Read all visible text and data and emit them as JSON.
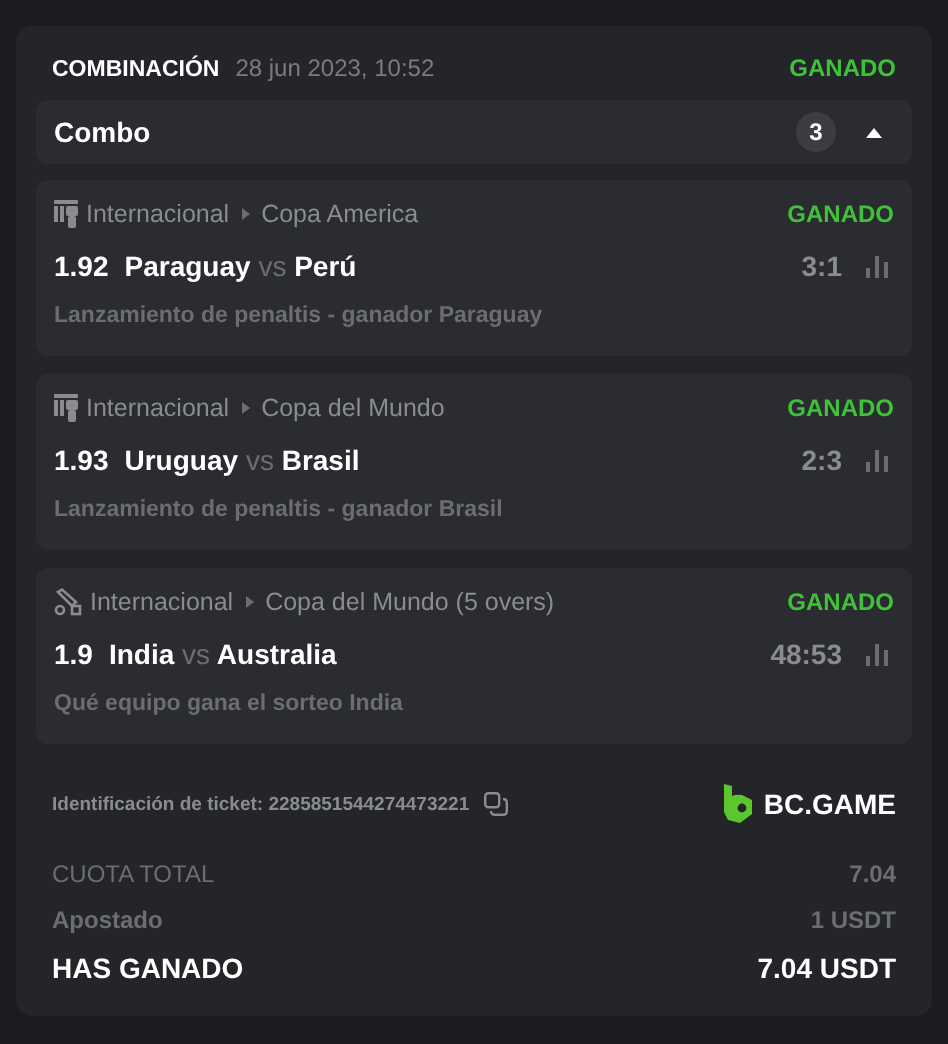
{
  "header": {
    "type": "COMBINACIÓN",
    "date": "28 jun 2023, 10:52",
    "status": "GANADO"
  },
  "combo": {
    "label": "Combo",
    "count": "3",
    "expanded": true
  },
  "legs": [
    {
      "kind": "penalty",
      "category": "Internacional",
      "league": "Copa America",
      "status": "GANADO",
      "odds": "1.92",
      "home": "Paraguay",
      "vs": "vs",
      "away": "Perú",
      "score": "3:1",
      "market": "Lanzamiento de penaltis - ganador Paraguay"
    },
    {
      "kind": "penalty",
      "category": "Internacional",
      "league": "Copa del Mundo",
      "status": "GANADO",
      "odds": "1.93",
      "home": "Uruguay",
      "vs": "vs",
      "away": "Brasil",
      "score": "2:3",
      "market": "Lanzamiento de penaltis - ganador Brasil"
    },
    {
      "kind": "cricket",
      "category": "Internacional",
      "league": "Copa del Mundo (5 overs)",
      "status": "GANADO",
      "odds": "1.9",
      "home": "India",
      "vs": "vs",
      "away": "Australia",
      "score": "48:53",
      "market": "Qué equipo gana el sorteo India"
    }
  ],
  "ticket": {
    "label": "Identificación de ticket: 2285851544274473221",
    "brand": "BC.GAME"
  },
  "totals": [
    {
      "kind": "plain",
      "label": "CUOTA TOTAL",
      "value": "7.04"
    },
    {
      "kind": "plain",
      "label": "Apostado",
      "value": "1 USDT"
    },
    {
      "kind": "strong",
      "label": "HAS GANADO",
      "value": "7.04 USDT"
    }
  ]
}
